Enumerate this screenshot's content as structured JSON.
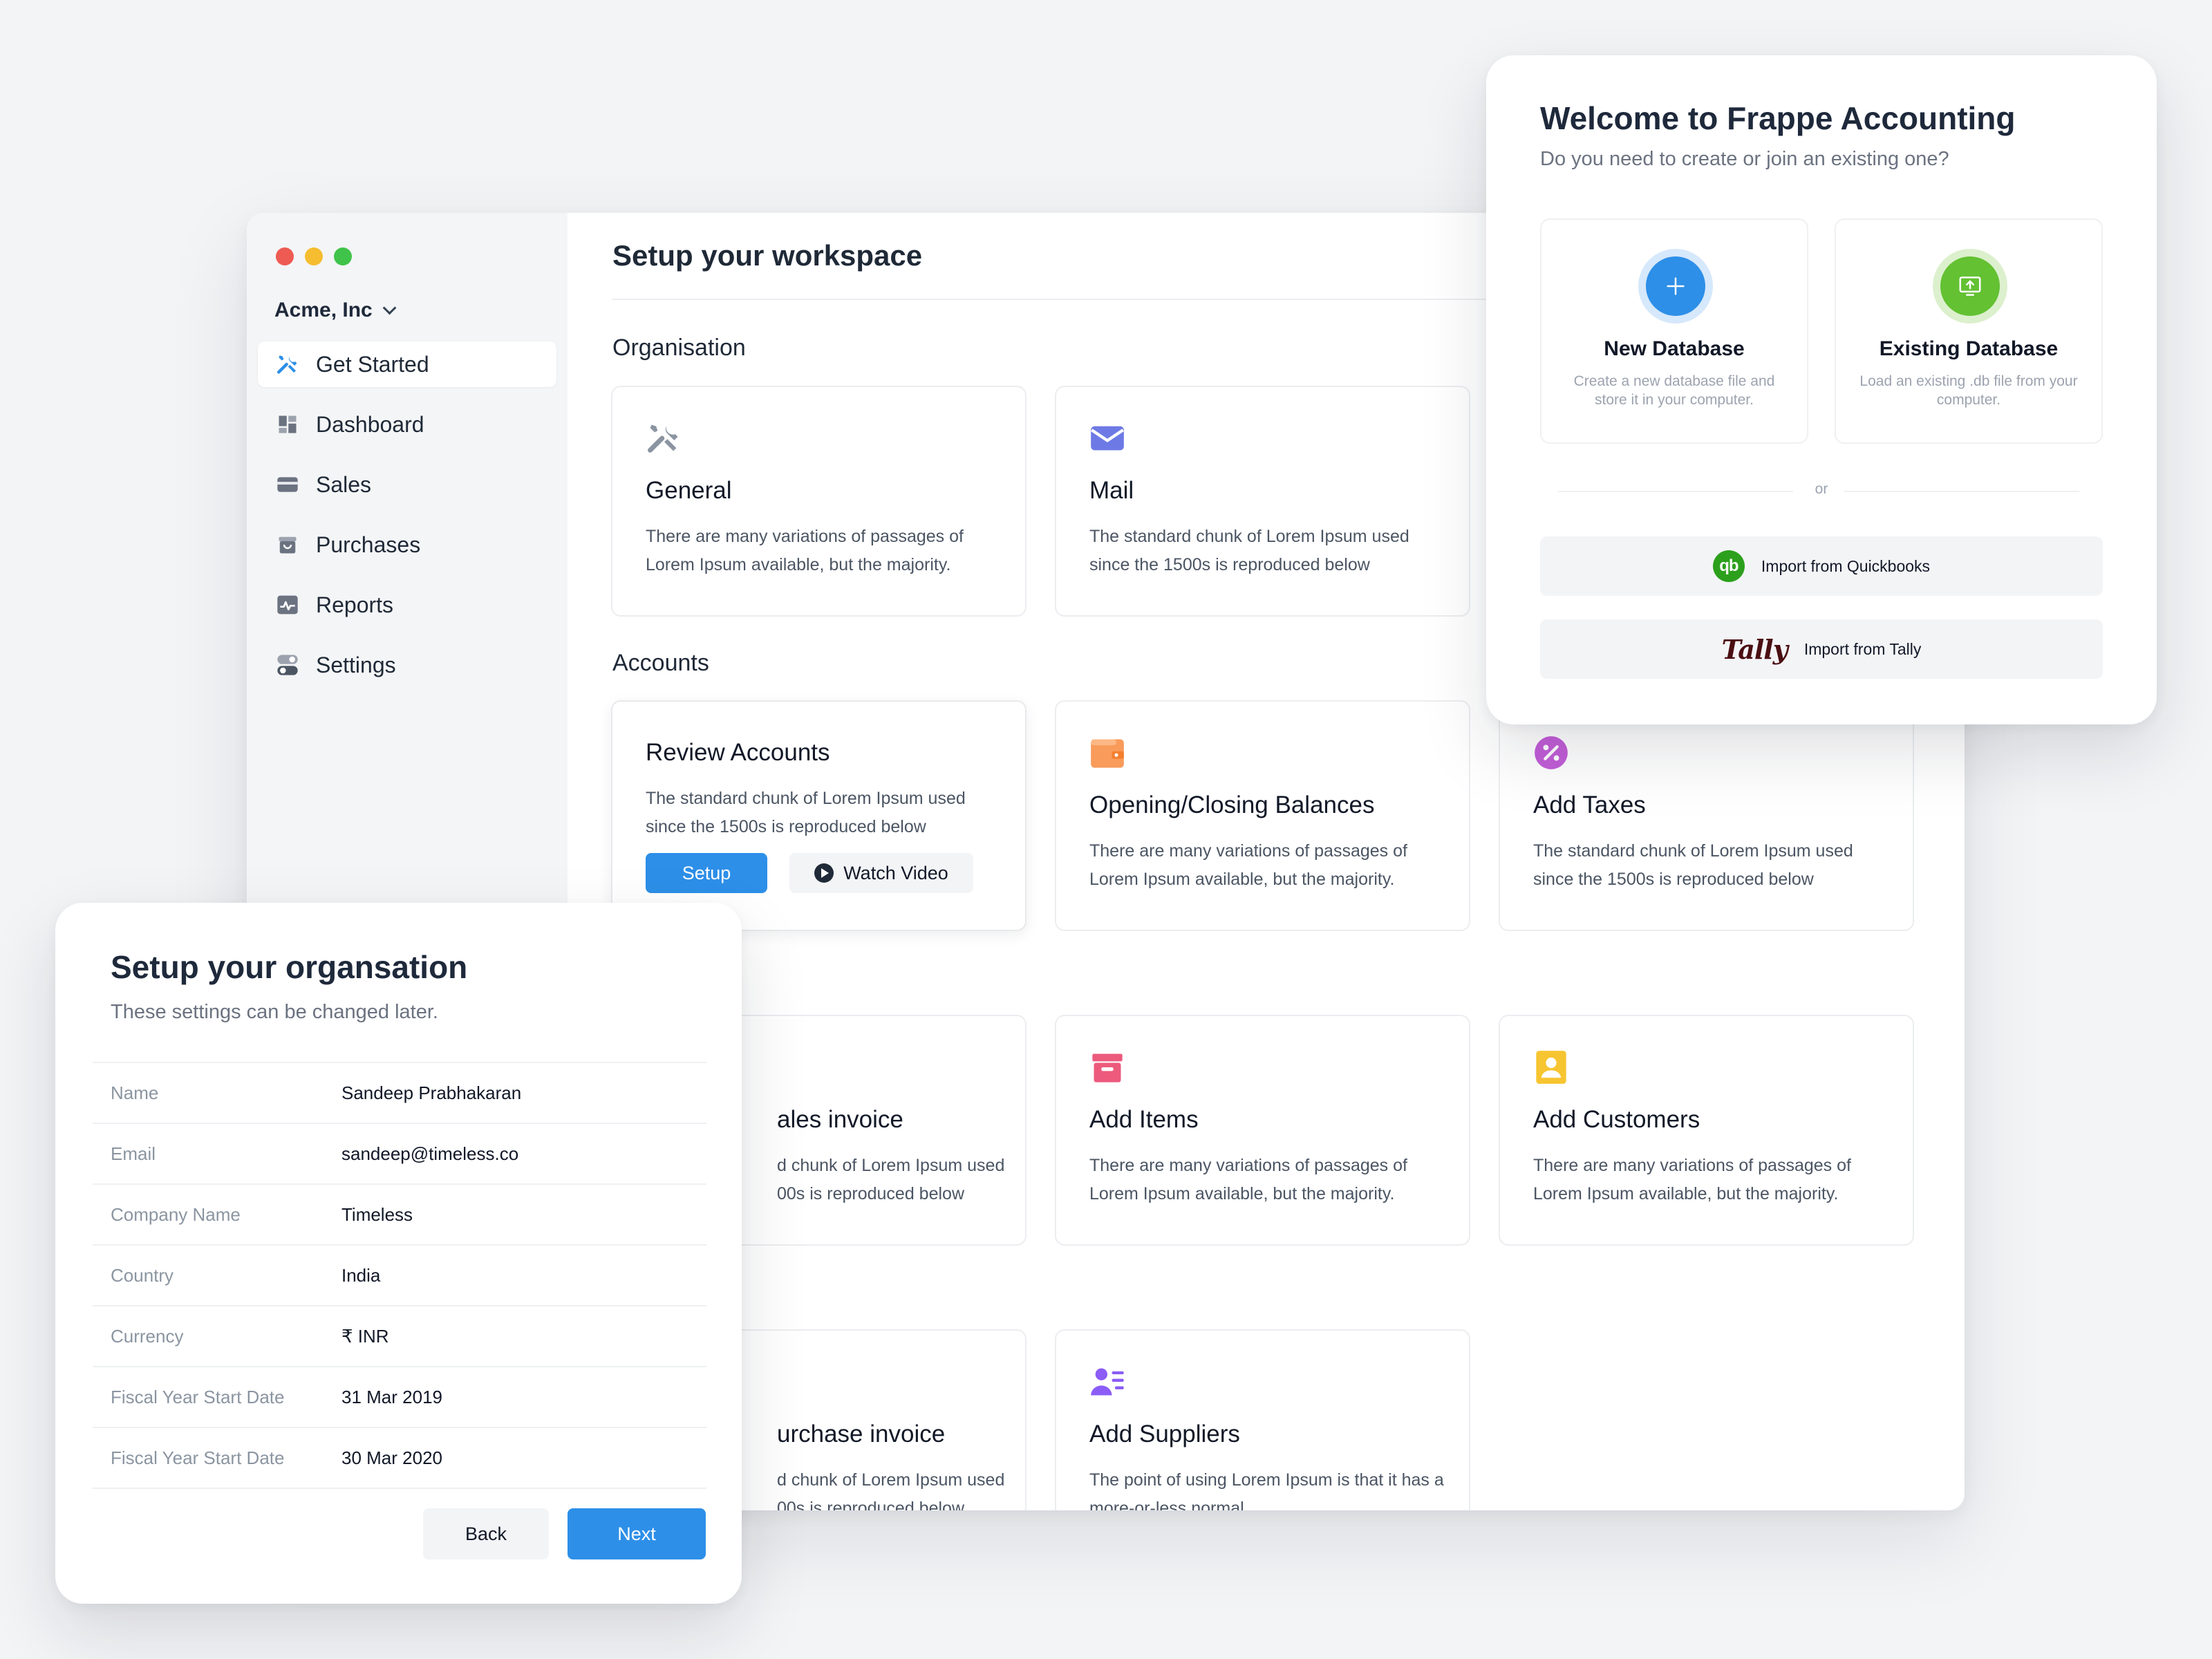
{
  "workspace": {
    "company": "Acme, Inc",
    "title": "Setup your workspace",
    "nav": [
      {
        "label": "Get Started",
        "icon": "tools-icon",
        "active": true
      },
      {
        "label": "Dashboard",
        "icon": "dashboard-icon"
      },
      {
        "label": "Sales",
        "icon": "card-icon"
      },
      {
        "label": "Purchases",
        "icon": "basket-icon"
      },
      {
        "label": "Reports",
        "icon": "chart-icon"
      },
      {
        "label": "Settings",
        "icon": "toggles-icon"
      }
    ],
    "sections": {
      "organisation": "Organisation",
      "accounts": "Accounts"
    },
    "cards": {
      "general": {
        "title": "General",
        "desc": "There are many variations of passages of Lorem Ipsum available, but the majority."
      },
      "mail": {
        "title": "Mail",
        "desc": "The standard chunk of Lorem Ipsum used since the 1500s is reproduced below"
      },
      "review": {
        "title": "Review Accounts",
        "desc": "The standard chunk of Lorem Ipsum used since the 1500s is reproduced below",
        "setup": "Setup",
        "video": "Watch Video"
      },
      "balances": {
        "title": "Opening/Closing Balances",
        "desc": "There are many variations of passages of Lorem Ipsum available, but the majority."
      },
      "taxes": {
        "title": "Add Taxes",
        "desc": "The standard chunk of Lorem Ipsum used since the 1500s is reproduced below"
      },
      "sales_invoice": {
        "title": "ales invoice",
        "desc": "d chunk of Lorem Ipsum used 00s is reproduced below"
      },
      "items": {
        "title": "Add Items",
        "desc": "There are many variations of passages of Lorem Ipsum available, but the majority."
      },
      "customers": {
        "title": "Add Customers",
        "desc": "There are many variations of passages of Lorem Ipsum available, but the majority."
      },
      "purchase_invoice": {
        "title": "urchase invoice",
        "desc": "d chunk of Lorem Ipsum used 00s is reproduced below"
      },
      "suppliers": {
        "title": "Add Suppliers",
        "desc": "The point of using Lorem Ipsum is that it has a more-or-less normal"
      }
    }
  },
  "welcome": {
    "title": "Welcome to Frappe Accounting",
    "subtitle": "Do you need to create or join an existing one?",
    "new_db": {
      "title": "New Database",
      "desc": "Create a new database file and store it in your computer."
    },
    "existing_db": {
      "title": "Existing Database",
      "desc": "Load an existing .db file from your computer."
    },
    "or": "or",
    "quickbooks": "Import from Quickbooks",
    "quickbooks_logo": "qb",
    "tally": "Import from Tally",
    "tally_logo": "Tally"
  },
  "org": {
    "title": "Setup your organsation",
    "subtitle": "These settings can be changed later.",
    "rows": [
      {
        "label": "Name",
        "value": "Sandeep Prabhakaran"
      },
      {
        "label": "Email",
        "value": "sandeep@timeless.co"
      },
      {
        "label": "Company Name",
        "value": "Timeless"
      },
      {
        "label": "Country",
        "value": "India"
      },
      {
        "label": "Currency",
        "value": "₹ INR"
      },
      {
        "label": "Fiscal Year Start Date",
        "value": "31 Mar  2019"
      },
      {
        "label": "Fiscal Year Start Date",
        "value": "30 Mar  2020"
      }
    ],
    "back": "Back",
    "next": "Next"
  },
  "colors": {
    "primary": "#2d8fe8",
    "traffic_red": "#ed5b52",
    "traffic_yellow": "#f5bd2f",
    "traffic_green": "#3fc34a",
    "new_db": "#2d8fe8",
    "existing_db": "#63c132"
  }
}
